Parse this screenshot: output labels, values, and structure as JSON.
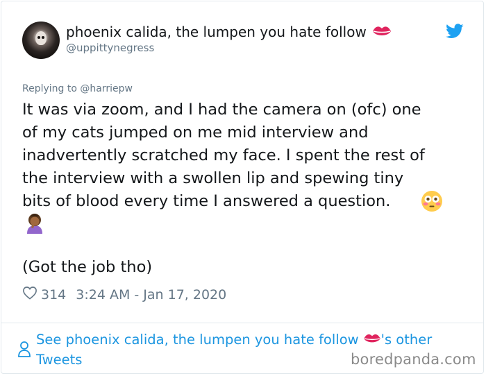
{
  "tweet": {
    "display_name": "phoenix calida, the lumpen you hate follow",
    "handle": "@uppittynegress",
    "replying_to": "Replying to @harriepw",
    "text_main": "It was via zoom, and I had the camera on (ofc) one\nof my cats jumped on me mid interview and\ninadvertently scratched my face. I spent the rest of\nthe interview with a swollen lip and spewing tiny\nbits of blood every time I answered a question.",
    "text_after": "(Got the job tho)",
    "likes": "314",
    "timestamp": "3:24 AM - Jan 17, 2020"
  },
  "footer": {
    "see_prefix": "See phoenix calida, the lumpen you hate follow",
    "see_suffix": "'s other",
    "see_line2": "Tweets"
  },
  "watermark": "boredpanda.com",
  "icons": {
    "lips": "kiss-mark-icon",
    "bird": "twitter-bird-icon",
    "flushed": "flushed-face-icon",
    "facepalm": "person-facepalming-icon",
    "heart": "heart-outline-icon",
    "person": "person-outline-icon"
  },
  "colors": {
    "link": "#1b95e0",
    "twitter_blue": "#1da1f2",
    "muted": "#657786",
    "text": "#14171a",
    "lips_red": "#e0245e"
  }
}
